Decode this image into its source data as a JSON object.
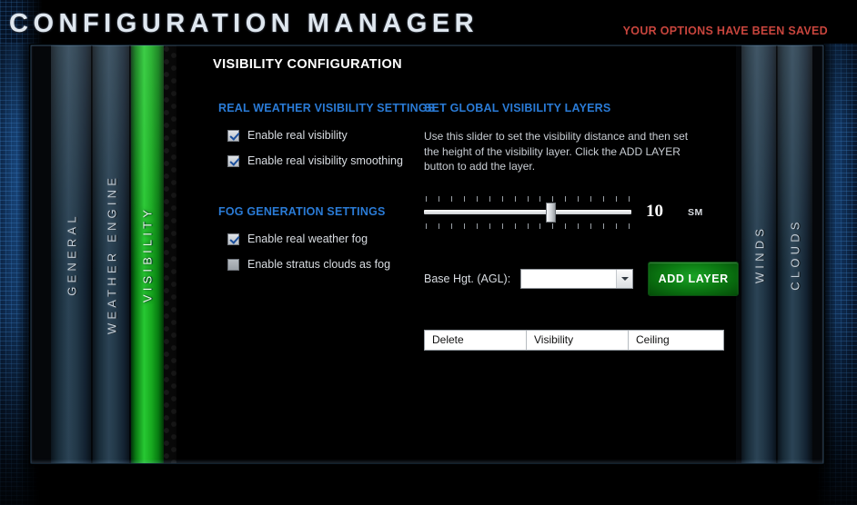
{
  "window": {
    "app_title": "CONFIGURATION MANAGER",
    "status_message": "YOUR OPTIONS HAVE BEEN SAVED",
    "status_color": "#c8453d"
  },
  "tabs_left": [
    {
      "label": "GENERAL",
      "active": false
    },
    {
      "label": "WEATHER ENGINE",
      "active": false
    },
    {
      "label": "VISIBILITY",
      "active": true
    }
  ],
  "tabs_right": [
    {
      "label": "WINDS",
      "active": false
    },
    {
      "label": "CLOUDS",
      "active": false
    }
  ],
  "page": {
    "title": "VISIBILITY CONFIGURATION"
  },
  "left_column": {
    "section1": {
      "heading": "REAL WEATHER VISIBILITY SETTINGS",
      "options": [
        {
          "label": "Enable real visibility",
          "checked": true
        },
        {
          "label": "Enable real visibility smoothing",
          "checked": true
        }
      ]
    },
    "section2": {
      "heading": "FOG GENERATION SETTINGS",
      "options": [
        {
          "label": "Enable real weather fog",
          "checked": true
        },
        {
          "label": "Enable stratus clouds as fog",
          "checked": false
        }
      ]
    }
  },
  "right_column": {
    "heading": "SET GLOBAL VISIBILITY LAYERS",
    "help_text": "Use this slider to set the visibility distance and then set the height of the visibility layer.  Click the ADD LAYER button to add the layer.",
    "slider": {
      "value": "10",
      "unit": "SM",
      "min": 0,
      "max": 17,
      "ticks": 17,
      "thumb_percent": 61
    },
    "base_height": {
      "label": "Base Hgt. (AGL):",
      "value": "",
      "placeholder": ""
    },
    "add_layer_button": "ADD LAYER",
    "layers_table": {
      "columns": [
        "Delete",
        "Visibility",
        "Ceiling"
      ],
      "rows": []
    }
  },
  "theme": {
    "accent_blue": "#2a7bd6",
    "active_tab_green": "#27c832",
    "button_green": "#0b7a12"
  }
}
